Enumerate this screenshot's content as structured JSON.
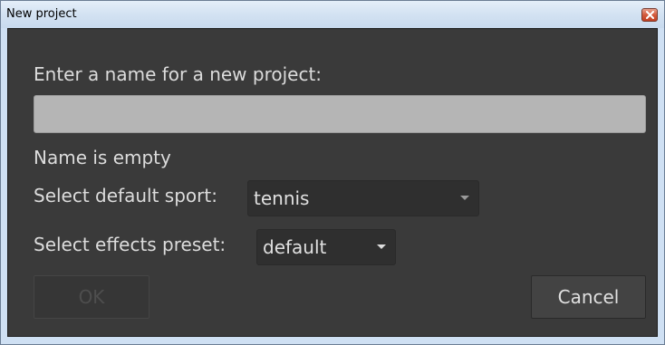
{
  "window": {
    "title": "New project",
    "close_icon": "close-icon"
  },
  "form": {
    "prompt_label": "Enter a name for a new project:",
    "name_value": "",
    "validation_message": "Name is empty",
    "sport_label": "Select default sport:",
    "sport_value": "tennis",
    "preset_label": "Select effects preset:",
    "preset_value": "default"
  },
  "buttons": {
    "ok_label": "OK",
    "ok_enabled": false,
    "cancel_label": "Cancel"
  },
  "colors": {
    "dialog_background": "#3a3a3a",
    "input_background": "#b5b5b5",
    "text": "#dcdcdc"
  }
}
